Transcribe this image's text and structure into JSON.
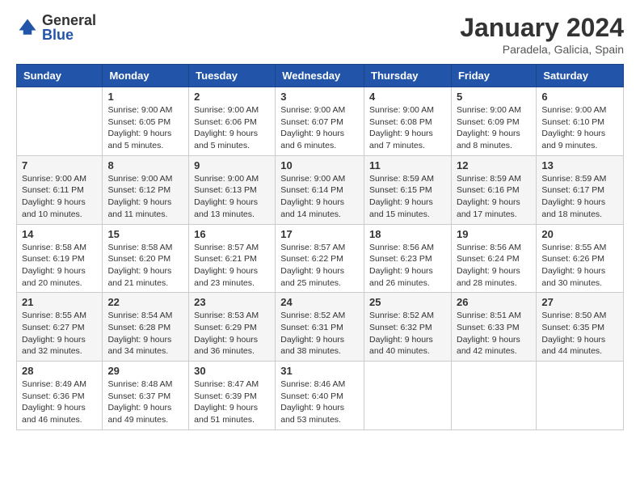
{
  "logo": {
    "general": "General",
    "blue": "Blue"
  },
  "title": {
    "month_year": "January 2024",
    "location": "Paradela, Galicia, Spain"
  },
  "days_of_week": [
    "Sunday",
    "Monday",
    "Tuesday",
    "Wednesday",
    "Thursday",
    "Friday",
    "Saturday"
  ],
  "weeks": [
    [
      {
        "day": "",
        "detail": ""
      },
      {
        "day": "1",
        "detail": "Sunrise: 9:00 AM\nSunset: 6:05 PM\nDaylight: 9 hours\nand 5 minutes."
      },
      {
        "day": "2",
        "detail": "Sunrise: 9:00 AM\nSunset: 6:06 PM\nDaylight: 9 hours\nand 5 minutes."
      },
      {
        "day": "3",
        "detail": "Sunrise: 9:00 AM\nSunset: 6:07 PM\nDaylight: 9 hours\nand 6 minutes."
      },
      {
        "day": "4",
        "detail": "Sunrise: 9:00 AM\nSunset: 6:08 PM\nDaylight: 9 hours\nand 7 minutes."
      },
      {
        "day": "5",
        "detail": "Sunrise: 9:00 AM\nSunset: 6:09 PM\nDaylight: 9 hours\nand 8 minutes."
      },
      {
        "day": "6",
        "detail": "Sunrise: 9:00 AM\nSunset: 6:10 PM\nDaylight: 9 hours\nand 9 minutes."
      }
    ],
    [
      {
        "day": "7",
        "detail": "Sunrise: 9:00 AM\nSunset: 6:11 PM\nDaylight: 9 hours\nand 10 minutes."
      },
      {
        "day": "8",
        "detail": "Sunrise: 9:00 AM\nSunset: 6:12 PM\nDaylight: 9 hours\nand 11 minutes."
      },
      {
        "day": "9",
        "detail": "Sunrise: 9:00 AM\nSunset: 6:13 PM\nDaylight: 9 hours\nand 13 minutes."
      },
      {
        "day": "10",
        "detail": "Sunrise: 9:00 AM\nSunset: 6:14 PM\nDaylight: 9 hours\nand 14 minutes."
      },
      {
        "day": "11",
        "detail": "Sunrise: 8:59 AM\nSunset: 6:15 PM\nDaylight: 9 hours\nand 15 minutes."
      },
      {
        "day": "12",
        "detail": "Sunrise: 8:59 AM\nSunset: 6:16 PM\nDaylight: 9 hours\nand 17 minutes."
      },
      {
        "day": "13",
        "detail": "Sunrise: 8:59 AM\nSunset: 6:17 PM\nDaylight: 9 hours\nand 18 minutes."
      }
    ],
    [
      {
        "day": "14",
        "detail": "Sunrise: 8:58 AM\nSunset: 6:19 PM\nDaylight: 9 hours\nand 20 minutes."
      },
      {
        "day": "15",
        "detail": "Sunrise: 8:58 AM\nSunset: 6:20 PM\nDaylight: 9 hours\nand 21 minutes."
      },
      {
        "day": "16",
        "detail": "Sunrise: 8:57 AM\nSunset: 6:21 PM\nDaylight: 9 hours\nand 23 minutes."
      },
      {
        "day": "17",
        "detail": "Sunrise: 8:57 AM\nSunset: 6:22 PM\nDaylight: 9 hours\nand 25 minutes."
      },
      {
        "day": "18",
        "detail": "Sunrise: 8:56 AM\nSunset: 6:23 PM\nDaylight: 9 hours\nand 26 minutes."
      },
      {
        "day": "19",
        "detail": "Sunrise: 8:56 AM\nSunset: 6:24 PM\nDaylight: 9 hours\nand 28 minutes."
      },
      {
        "day": "20",
        "detail": "Sunrise: 8:55 AM\nSunset: 6:26 PM\nDaylight: 9 hours\nand 30 minutes."
      }
    ],
    [
      {
        "day": "21",
        "detail": "Sunrise: 8:55 AM\nSunset: 6:27 PM\nDaylight: 9 hours\nand 32 minutes."
      },
      {
        "day": "22",
        "detail": "Sunrise: 8:54 AM\nSunset: 6:28 PM\nDaylight: 9 hours\nand 34 minutes."
      },
      {
        "day": "23",
        "detail": "Sunrise: 8:53 AM\nSunset: 6:29 PM\nDaylight: 9 hours\nand 36 minutes."
      },
      {
        "day": "24",
        "detail": "Sunrise: 8:52 AM\nSunset: 6:31 PM\nDaylight: 9 hours\nand 38 minutes."
      },
      {
        "day": "25",
        "detail": "Sunrise: 8:52 AM\nSunset: 6:32 PM\nDaylight: 9 hours\nand 40 minutes."
      },
      {
        "day": "26",
        "detail": "Sunrise: 8:51 AM\nSunset: 6:33 PM\nDaylight: 9 hours\nand 42 minutes."
      },
      {
        "day": "27",
        "detail": "Sunrise: 8:50 AM\nSunset: 6:35 PM\nDaylight: 9 hours\nand 44 minutes."
      }
    ],
    [
      {
        "day": "28",
        "detail": "Sunrise: 8:49 AM\nSunset: 6:36 PM\nDaylight: 9 hours\nand 46 minutes."
      },
      {
        "day": "29",
        "detail": "Sunrise: 8:48 AM\nSunset: 6:37 PM\nDaylight: 9 hours\nand 49 minutes."
      },
      {
        "day": "30",
        "detail": "Sunrise: 8:47 AM\nSunset: 6:39 PM\nDaylight: 9 hours\nand 51 minutes."
      },
      {
        "day": "31",
        "detail": "Sunrise: 8:46 AM\nSunset: 6:40 PM\nDaylight: 9 hours\nand 53 minutes."
      },
      {
        "day": "",
        "detail": ""
      },
      {
        "day": "",
        "detail": ""
      },
      {
        "day": "",
        "detail": ""
      }
    ]
  ]
}
